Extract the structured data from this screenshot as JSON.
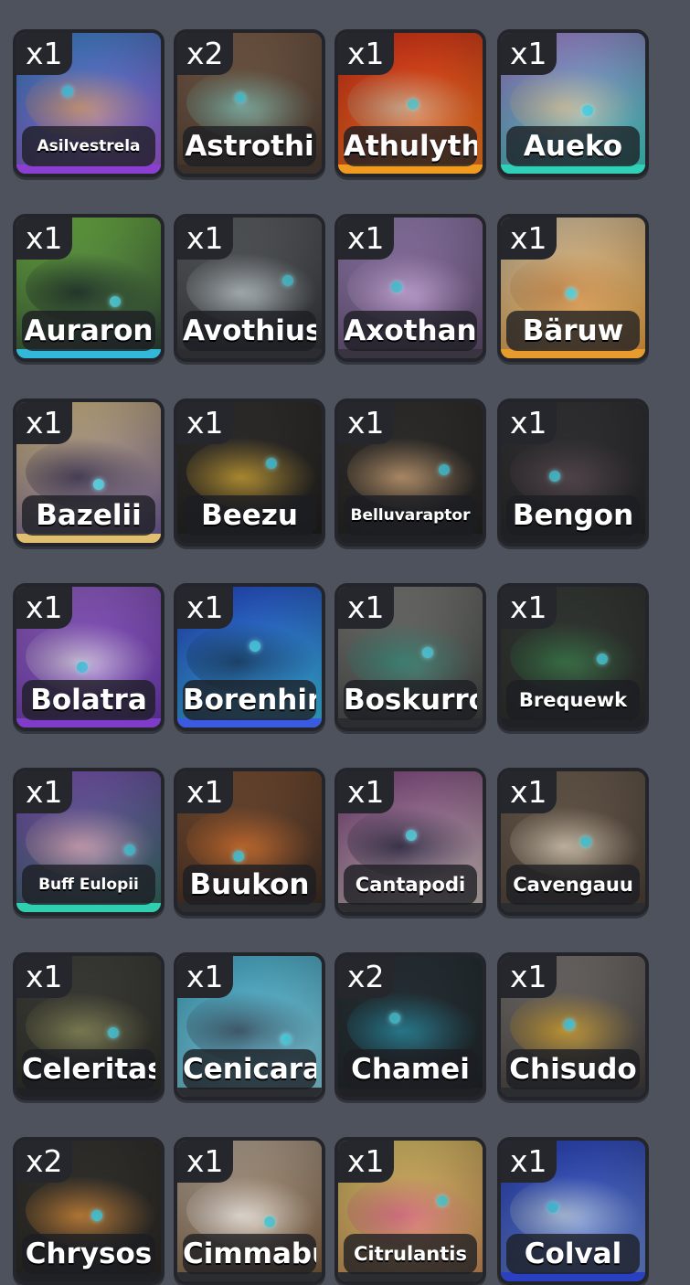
{
  "items": [
    {
      "name": "Asilvestrela",
      "qty": "x1",
      "bg": [
        "#3b8fd8",
        "#a65bd6"
      ],
      "tint": "#d49a6a",
      "rarity": "#8a3fd1",
      "size": "xs"
    },
    {
      "name": "Astrothi",
      "qty": "x2",
      "bg": [
        "#8a6a52",
        "#4a3a30"
      ],
      "tint": "#7fb8ae",
      "rarity": "#3b2f29",
      "size": ""
    },
    {
      "name": "Athulyth",
      "qty": "x1",
      "bg": [
        "#e8331c",
        "#f07a1e"
      ],
      "tint": "#c9b39a",
      "rarity": "#f09a20",
      "size": ""
    },
    {
      "name": "Aueko",
      "qty": "x1",
      "bg": [
        "#b58ae0",
        "#3ad2c2"
      ],
      "tint": "#d8c39a",
      "rarity": "#2fcfb8",
      "size": ""
    },
    {
      "name": "Auraron",
      "qty": "x1",
      "bg": [
        "#7fcf4e",
        "#2a3a36"
      ],
      "tint": "#1e2c2a",
      "rarity": "#32b8d8",
      "size": ""
    },
    {
      "name": "Avothius",
      "qty": "x1",
      "bg": [
        "#6a6e72",
        "#2e3034"
      ],
      "tint": "#b9c2c6",
      "rarity": "#2b2d31",
      "size": ""
    },
    {
      "name": "Axothan",
      "qty": "x1",
      "bg": [
        "#a88ec8",
        "#5e4a6a"
      ],
      "tint": "#c6a6d6",
      "rarity": "#3a3340",
      "size": ""
    },
    {
      "name": "Bäruw",
      "qty": "x1",
      "bg": [
        "#e8d6b8",
        "#e8a03a"
      ],
      "tint": "#c98a4e",
      "rarity": "#e89a2c",
      "size": ""
    },
    {
      "name": "Bazelii",
      "qty": "x1",
      "bg": [
        "#e8cf8e",
        "#6a5a9a"
      ],
      "tint": "#3a3450",
      "rarity": "#e0c070",
      "size": ""
    },
    {
      "name": "Beezu",
      "qty": "x1",
      "bg": [
        "#3a3836",
        "#1e1d1c"
      ],
      "tint": "#c9a034",
      "rarity": "#1f2125",
      "size": ""
    },
    {
      "name": "Belluvaraptor",
      "qty": "x1",
      "bg": [
        "#3a3836",
        "#222120"
      ],
      "tint": "#c9a074",
      "rarity": "#1f2125",
      "size": "xs"
    },
    {
      "name": "Bengon",
      "qty": "x1",
      "bg": [
        "#3c3c3e",
        "#242426"
      ],
      "tint": "#5a4a50",
      "rarity": "#1f2125",
      "size": ""
    },
    {
      "name": "Bolatra",
      "qty": "x1",
      "bg": [
        "#a26ad6",
        "#6a3ab0"
      ],
      "tint": "#d8d0de",
      "rarity": "#7e3cc8",
      "size": ""
    },
    {
      "name": "Borenhir",
      "qty": "x1",
      "bg": [
        "#2a4ad8",
        "#3ac0e0"
      ],
      "tint": "#1a3a5a",
      "rarity": "#3a5ae0",
      "size": ""
    },
    {
      "name": "Boskurro",
      "qty": "x1",
      "bg": [
        "#8a8a86",
        "#3a3e3c"
      ],
      "tint": "#3a8a7a",
      "rarity": "#2b2d31",
      "size": ""
    },
    {
      "name": "Brequewk",
      "qty": "x1",
      "bg": [
        "#3c423c",
        "#2a2c2a"
      ],
      "tint": "#3a7a4a",
      "rarity": "#1f2125",
      "size": "sm"
    },
    {
      "name": "Buff Eulopii",
      "qty": "x1",
      "bg": [
        "#8a5ac8",
        "#2e6a5a"
      ],
      "tint": "#d8a6b4",
      "rarity": "#2fcfb0",
      "size": "xs"
    },
    {
      "name": "Buukon",
      "qty": "x1",
      "bg": [
        "#8a5a3a",
        "#3a2a22"
      ],
      "tint": "#d0702e",
      "rarity": "#2b2d31",
      "size": ""
    },
    {
      "name": "Cantapodi",
      "qty": "x1",
      "bg": [
        "#8a4a8a",
        "#c8c0b8"
      ],
      "tint": "#2a2a40",
      "rarity": "#2b2d31",
      "size": "sm"
    },
    {
      "name": "Cavengauu",
      "qty": "x1",
      "bg": [
        "#7a6a5a",
        "#4a3e34"
      ],
      "tint": "#d6cab4",
      "rarity": "#2b2d31",
      "size": "sm"
    },
    {
      "name": "Celeritas",
      "qty": "x1",
      "bg": [
        "#4a4a44",
        "#2a2a26"
      ],
      "tint": "#8a8a5a",
      "rarity": "#1f2125",
      "size": ""
    },
    {
      "name": "Cenicara",
      "qty": "x1",
      "bg": [
        "#4ab8d8",
        "#8ad0e0"
      ],
      "tint": "#3a4a5a",
      "rarity": "#2b2d31",
      "size": ""
    },
    {
      "name": "Chamei",
      "qty": "x2",
      "bg": [
        "#2e3a40",
        "#1e2428"
      ],
      "tint": "#2a8aa0",
      "rarity": "#1f2125",
      "size": ""
    },
    {
      "name": "Chisudo",
      "qty": "x1",
      "bg": [
        "#8a8480",
        "#3e3a36"
      ],
      "tint": "#d0a030",
      "rarity": "#2b2d31",
      "size": ""
    },
    {
      "name": "Chrysos",
      "qty": "x2",
      "bg": [
        "#3a3a36",
        "#2a2622"
      ],
      "tint": "#d0883a",
      "rarity": "#1f2125",
      "size": ""
    },
    {
      "name": "Cimmabu",
      "qty": "x1",
      "bg": [
        "#c8b8a8",
        "#7a5a3a"
      ],
      "tint": "#f0ece8",
      "rarity": "#2b2d31",
      "size": ""
    },
    {
      "name": "Citrulantis",
      "qty": "x1",
      "bg": [
        "#e8d070",
        "#c88a5a"
      ],
      "tint": "#d86a8a",
      "rarity": "#2b2d31",
      "size": "sm"
    },
    {
      "name": "Colval",
      "qty": "x1",
      "bg": [
        "#2a44c8",
        "#6a8ad0"
      ],
      "tint": "#b8c8d8",
      "rarity": "#2a40c0",
      "size": ""
    }
  ]
}
